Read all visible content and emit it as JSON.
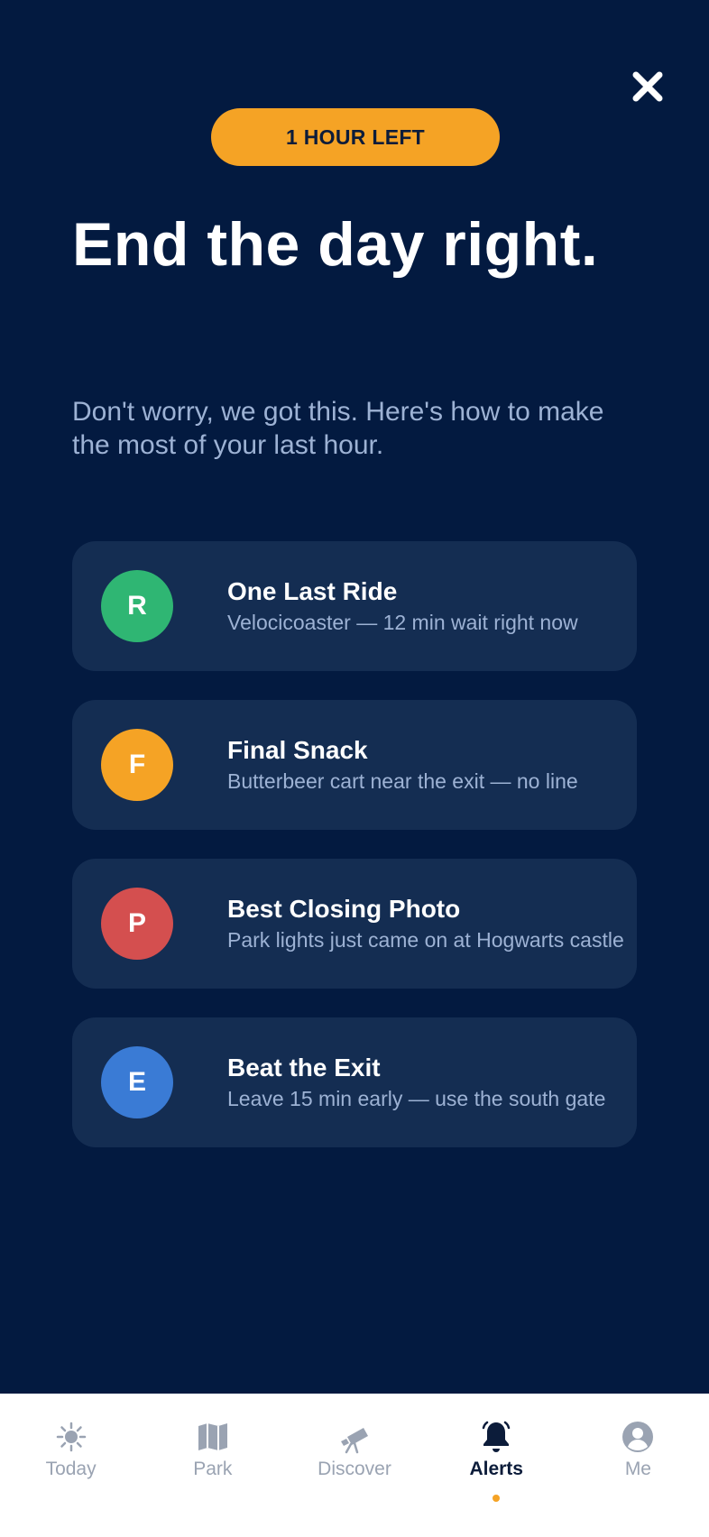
{
  "header": {
    "badge": "1 HOUR LEFT",
    "title": "End the day right.",
    "subtitle": "Don't worry, we got this. Here's how to make the most of your last hour."
  },
  "cards": [
    {
      "initial": "R",
      "title": "One Last Ride",
      "desc": "Velocicoaster — 12 min wait right now",
      "color": "#2fb673"
    },
    {
      "initial": "F",
      "title": "Final Snack",
      "desc": "Butterbeer cart near the exit — no line",
      "color": "#f5a325"
    },
    {
      "initial": "P",
      "title": "Best Closing Photo",
      "desc": "Park lights just came on at Hogwarts castle",
      "color": "#d44f4f"
    },
    {
      "initial": "E",
      "title": "Beat the Exit",
      "desc": "Leave 15 min early — use the south gate",
      "color": "#3a7bd5"
    }
  ],
  "tabbar": {
    "tabs": [
      {
        "label": "Today",
        "icon": "sun-icon"
      },
      {
        "label": "Park",
        "icon": "map-icon"
      },
      {
        "label": "Discover",
        "icon": "telescope-icon"
      },
      {
        "label": "Alerts",
        "icon": "bell-icon",
        "active": true
      },
      {
        "label": "Me",
        "icon": "user-icon"
      }
    ]
  },
  "colors": {
    "background": "#031a40",
    "card": "#142d52",
    "accent": "#f5a325",
    "muted_text": "#9db2d4"
  }
}
